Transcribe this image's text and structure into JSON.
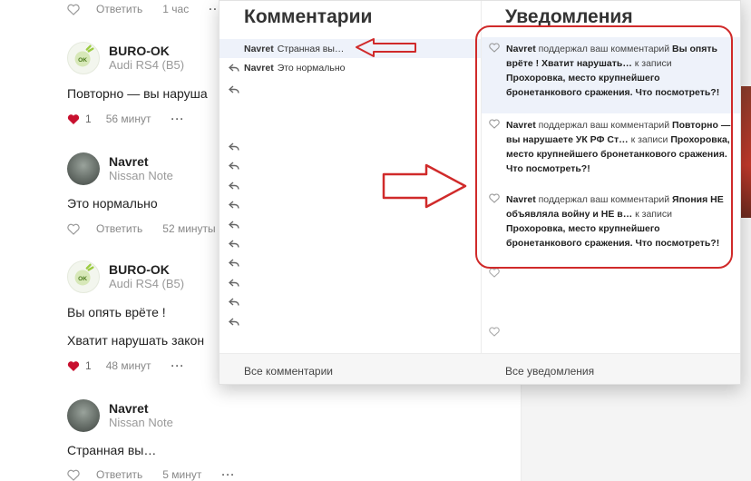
{
  "feed": {
    "top_meta": {
      "reply": "Ответить",
      "time": "1 час",
      "more": "···"
    },
    "comments": [
      {
        "user": "BURO-OK",
        "car": "Audi RS4 (B5)",
        "avatar": "ok-logo-avatar",
        "lines": [
          "Повторно — вы наруша"
        ],
        "likes": "1",
        "time": "56 минут",
        "more": "···",
        "liked": true
      },
      {
        "user": "Navret",
        "car": "Nissan Note",
        "avatar": "photo-avatar",
        "lines": [
          "Это нормально"
        ],
        "reply": "Ответить",
        "time": "52 минуты",
        "more": "···",
        "liked": false
      },
      {
        "user": "BURO-OK",
        "car": "Audi RS4 (B5)",
        "avatar": "ok-logo-avatar",
        "lines": [
          "Вы опять врёте !",
          "Хватит нарушать закон"
        ],
        "likes": "1",
        "time": "48 минут",
        "more": "···",
        "liked": true
      },
      {
        "user": "Navret",
        "car": "Nissan Note",
        "avatar": "photo-avatar",
        "lines": [
          "Странная вы…"
        ],
        "reply": "Ответить",
        "time": "5 минут",
        "more": "···",
        "liked": false
      }
    ]
  },
  "popup": {
    "comments_title": "Комментарии",
    "notifications_title": "Уведомления",
    "comments": [
      {
        "user": "Navret",
        "text": "Странная вы…",
        "active": true
      },
      {
        "user": "Navret",
        "text": "Это нормально",
        "active": false
      }
    ],
    "notifications": [
      {
        "user": "Navret",
        "action": " поддержал ваш комментарий ",
        "comment": "Вы опять врёте ! Хватит нарушать…",
        "to": " к записи ",
        "post": "Прохоровка, место крупнейшего бронетанкового сражения. Что посмотреть?!",
        "active": true
      },
      {
        "user": "Navret",
        "action": " поддержал ваш комментарий ",
        "comment": "Повторно — вы нарушаете УК РФ Ст…",
        "to": " к записи ",
        "post": "Прохоровка, место крупнейшего бронетанкового сражения. Что посмотреть?!",
        "active": false
      },
      {
        "user": "Navret",
        "action": " поддержал ваш комментарий ",
        "comment": "Япония НЕ объявляла войну и НЕ в…",
        "to": " к записи ",
        "post": "Прохоровка, место крупнейшего бронетанкового сражения. Что посмотреть?!",
        "active": false
      }
    ],
    "footer": {
      "all_comments": "Все комментарии",
      "all_notifications": "Все уведомления"
    }
  },
  "colors": {
    "annotation_red": "#d02a2a",
    "like_red": "#c8102e",
    "active_row": "#eef2fa"
  }
}
